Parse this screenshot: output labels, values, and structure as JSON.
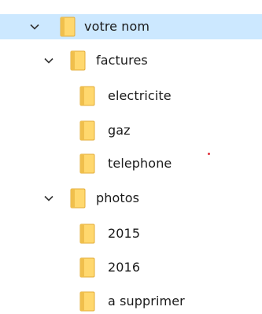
{
  "tree": {
    "items": [
      {
        "label": "votre nom",
        "expanded": true,
        "selected": true,
        "icon": "folder-icon"
      },
      {
        "label": "factures",
        "expanded": true,
        "selected": false,
        "icon": "folder-icon"
      },
      {
        "label": "electricite",
        "selected": false,
        "icon": "folder-icon"
      },
      {
        "label": "gaz",
        "selected": false,
        "icon": "folder-icon"
      },
      {
        "label": "telephone",
        "selected": false,
        "icon": "folder-icon"
      },
      {
        "label": "photos",
        "expanded": true,
        "selected": false,
        "icon": "folder-icon"
      },
      {
        "label": "2015",
        "selected": false,
        "icon": "folder-icon"
      },
      {
        "label": "2016",
        "selected": false,
        "icon": "folder-icon"
      },
      {
        "label": "a supprimer",
        "selected": false,
        "icon": "folder-icon"
      }
    ]
  },
  "colors": {
    "selection": "#cce8ff",
    "folder_body": "#ffd86e",
    "folder_edge": "#e3ad3a",
    "chevron": "#333333",
    "marker": "#e0323c"
  }
}
